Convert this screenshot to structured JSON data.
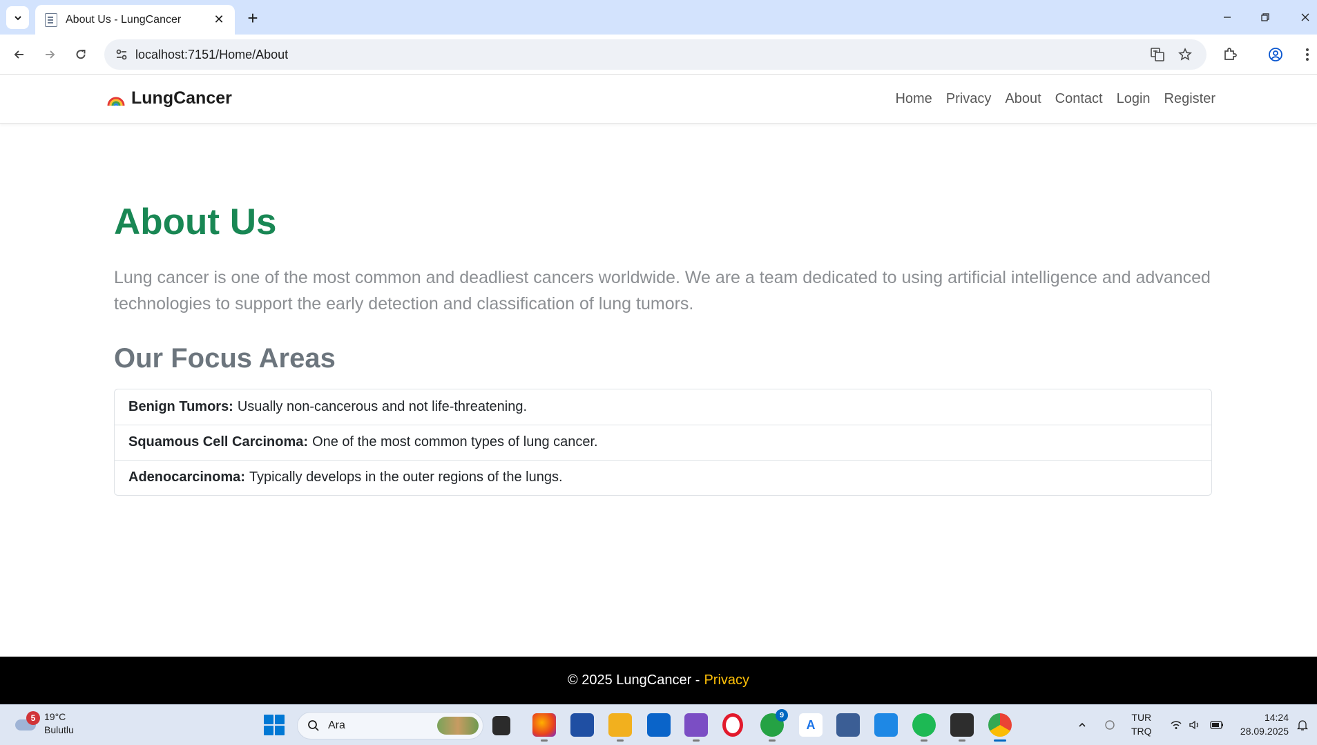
{
  "browser": {
    "tab_title": "About Us - LungCancer",
    "url": "localhost:7151/Home/About"
  },
  "site": {
    "brand": "LungCancer",
    "nav": [
      "Home",
      "Privacy",
      "About",
      "Contact",
      "Login",
      "Register"
    ]
  },
  "main": {
    "title": "About Us",
    "lead": "Lung cancer is one of the most common and deadliest cancers worldwide. We are a team dedicated to using artificial intelligence and advanced technologies to support the early detection and classification of lung tumors.",
    "focus_title": "Our Focus Areas",
    "focus_areas": [
      {
        "term": "Benign Tumors:",
        "desc": "Usually non-cancerous and not life-threatening."
      },
      {
        "term": "Squamous Cell Carcinoma:",
        "desc": "One of the most common types of lung cancer."
      },
      {
        "term": "Adenocarcinoma:",
        "desc": "Typically develops in the outer regions of the lungs."
      }
    ]
  },
  "footer": {
    "copyright": "© 2025 LungCancer -",
    "privacy_link": "Privacy"
  },
  "taskbar": {
    "weather_badge": "5",
    "temperature": "19°C",
    "weather_desc": "Bulutlu",
    "search_placeholder": "Ara",
    "whatsapp_badge": "9",
    "lang_top": "TUR",
    "lang_bottom": "TRQ",
    "time": "14:24",
    "date": "28.09.2025"
  },
  "colors": {
    "accent_green": "#198754",
    "footer_link": "#ffc107",
    "tabstrip": "#d3e3fd"
  }
}
